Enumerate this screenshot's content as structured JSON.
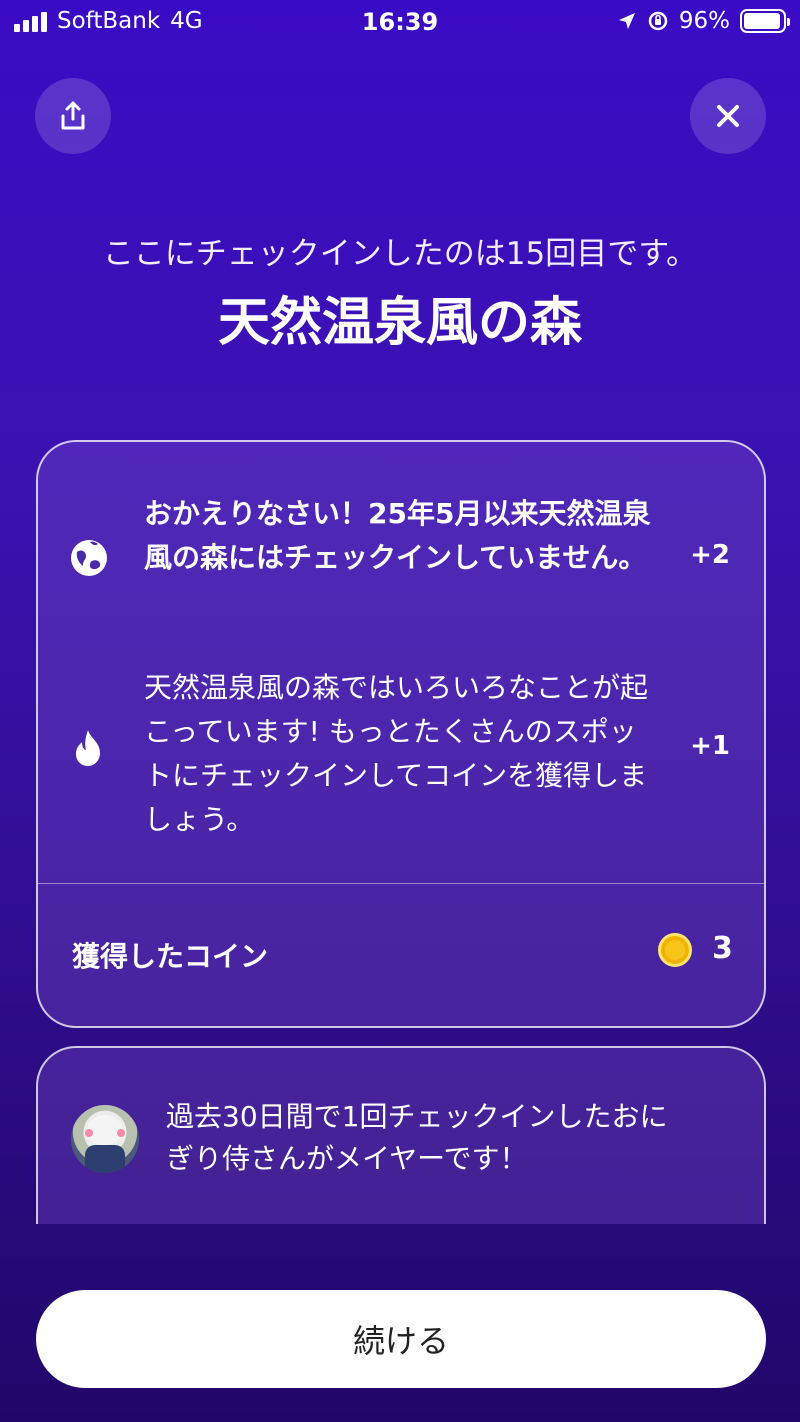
{
  "status_bar": {
    "carrier": "SoftBank",
    "network": "4G",
    "time": "16:39",
    "battery": "96%",
    "battery_level": 0.96
  },
  "header": {
    "share_icon": "share-icon",
    "close_icon": "close-icon"
  },
  "checkin": {
    "subtitle": "ここにチェックインしたのは15回目です。",
    "title": "天然温泉風の森"
  },
  "rewards": [
    {
      "icon": "globe-icon",
      "text": "おかえりなさい！25年5月以来天然温泉風の森にはチェックインしていません。",
      "points": "+2"
    },
    {
      "icon": "flame-icon",
      "text": "天然温泉風の森ではいろいろなことが起こっています! もっとたくさんのスポットにチェックインしてコインを獲得しましょう。",
      "points": "+1"
    }
  ],
  "coins": {
    "label": "獲得したコイン",
    "value": "3",
    "color": "#f7c51a"
  },
  "mayor": {
    "text": "過去30日間で1回チェックインしたおにぎり侍さんがメイヤーです！"
  },
  "continue_button": "続ける",
  "colors": {
    "background_top": "#3a0bc4",
    "background_bottom": "#21066a"
  }
}
